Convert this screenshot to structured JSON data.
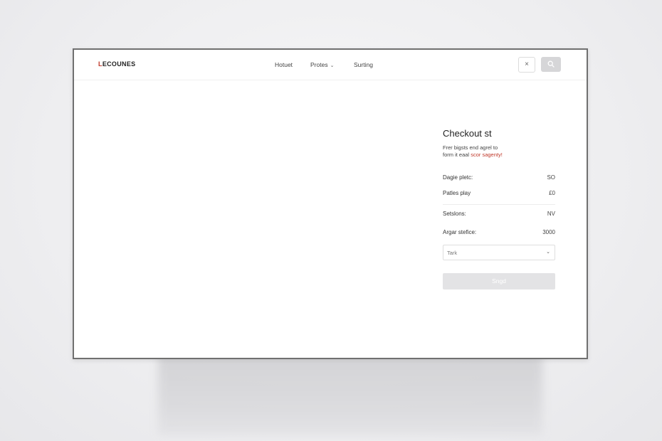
{
  "brand": {
    "logo_first": "L",
    "logo_rest": "ECOUNES",
    "accent_color": "#c0392b"
  },
  "nav": {
    "items": [
      {
        "label": "Hotuet"
      },
      {
        "label": "Protes",
        "has_dropdown": true,
        "chevron": "⌄"
      },
      {
        "label": "Surting"
      }
    ]
  },
  "toolbar": {
    "close_label": "×",
    "close_icon": "close-icon",
    "search_icon": "search-icon"
  },
  "checkout": {
    "title": "Checkout st",
    "desc_line1": "Frer bigsts end agrel to",
    "desc_line2_prefix": "form it eaal ",
    "desc_line2_highlight": "scor sagenty!",
    "rows": [
      {
        "label": "Dagie pletc:",
        "value": "SO"
      },
      {
        "label": "Patles play",
        "value": "£0"
      },
      {
        "label": "Setslons:",
        "value": "NV"
      },
      {
        "label": "Argar stefice:",
        "value": "3000"
      }
    ],
    "select": {
      "value": "Tark",
      "caret": "⌄"
    },
    "submit_label": "Sngd"
  }
}
